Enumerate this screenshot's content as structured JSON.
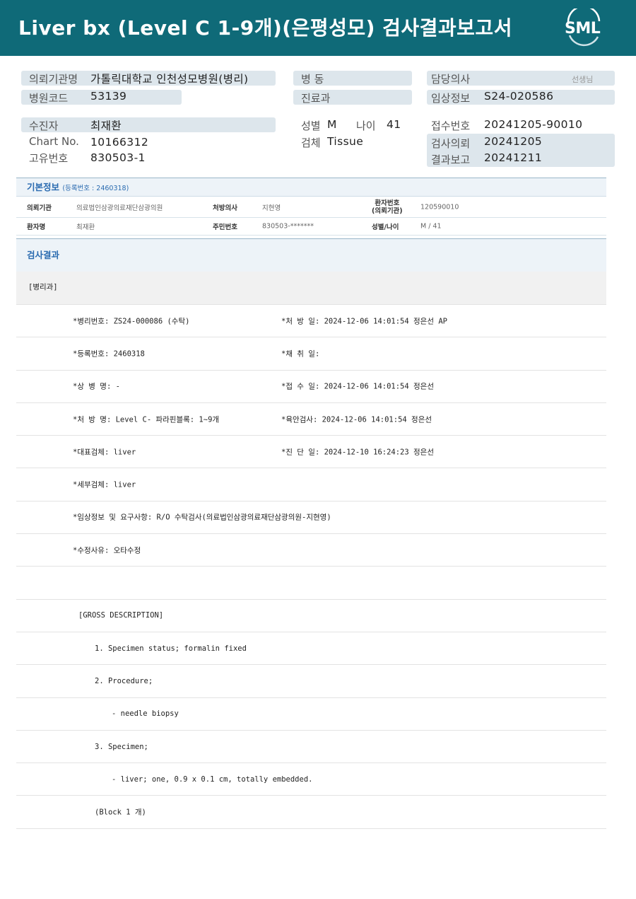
{
  "header": {
    "title": "Liver bx (Level C 1-9개)(은평성모) 검사결과보고서",
    "logo_text": "SML"
  },
  "info": {
    "institution_label": "의뢰기관명",
    "institution": "가톨릭대학교 인천성모병원(병리)",
    "hospital_code_label": "병원코드",
    "hospital_code": "53139",
    "ward_label": "병  동",
    "department_label": "진료과",
    "doctor_label": "담당의사",
    "doctor_suffix": "선생님",
    "clinical_label": "임상정보",
    "clinical": "S24-020586",
    "patient_label": "수진자",
    "patient": "최재환",
    "chart_label": "Chart No.",
    "chart": "10166312",
    "unique_label": "고유번호",
    "unique": "830503-1",
    "sex_label": "성별",
    "sex": "M",
    "age_label": "나이",
    "age": "41",
    "specimen_label": "검체",
    "specimen": "Tissue",
    "receipt_label": "접수번호",
    "receipt": "20241205-90010",
    "request_label": "검사의뢰",
    "request": "20241205",
    "report_label": "결과보고",
    "report": "20241211"
  },
  "basic": {
    "title": "기본정보",
    "reg": "(등록번호 : 2460318)",
    "row1": {
      "k1": "의뢰기관",
      "v1": "의료법인삼광의료재단삼광의원",
      "k2": "처방의사",
      "v2": "지현영",
      "k3a": "환자번호",
      "k3b": "(의뢰기관)",
      "v3": "120590010"
    },
    "row2": {
      "k1": "환자명",
      "v1": "최재환",
      "k2": "주민번호",
      "v2": "830503-*******",
      "k3": "성별/나이",
      "v3": "M / 41"
    }
  },
  "result": {
    "heading": "검사결과",
    "dept": "[병리과]",
    "rows": [
      {
        "a": "*병리번호: ZS24-000086 (수탁)",
        "b": "*처 방 일: 2024-12-06 14:01:54  정은선 AP"
      },
      {
        "a": "*등록번호: 2460318",
        "b": "*채 취 일:"
      },
      {
        "a": "*상 병 명: -",
        "b": "*접 수 일: 2024-12-06 14:01:54  정은선"
      },
      {
        "a": "*처 방 명: Level C- 파라핀블록: 1~9개",
        "b": "*육안검사: 2024-12-06 14:01:54  정은선"
      },
      {
        "a": "*대표검체: liver",
        "b": "*진 단 일: 2024-12-10 16:24:23  정은선"
      },
      {
        "a": "*세부검체: liver",
        "b": ""
      },
      {
        "a": "*임상정보 및 요구사항: R/O 수탁검사(의료법인삼광의료재단삼광의원-지현영)",
        "b": ""
      },
      {
        "a": "*수정사유: 오타수정",
        "b": ""
      },
      {
        "a": "",
        "b": ""
      }
    ],
    "gross": [
      {
        "text": "[GROSS DESCRIPTION]",
        "indent": 0
      },
      {
        "text": "1. Specimen status; formalin fixed",
        "indent": 1
      },
      {
        "text": "2. Procedure;",
        "indent": 1
      },
      {
        "text": "- needle biopsy",
        "indent": 2
      },
      {
        "text": "3. Specimen;",
        "indent": 1
      },
      {
        "text": "- liver; one, 0.9 x 0.1 cm, totally embedded.",
        "indent": 2
      },
      {
        "text": "(Block 1 개)",
        "indent": 1
      }
    ]
  }
}
